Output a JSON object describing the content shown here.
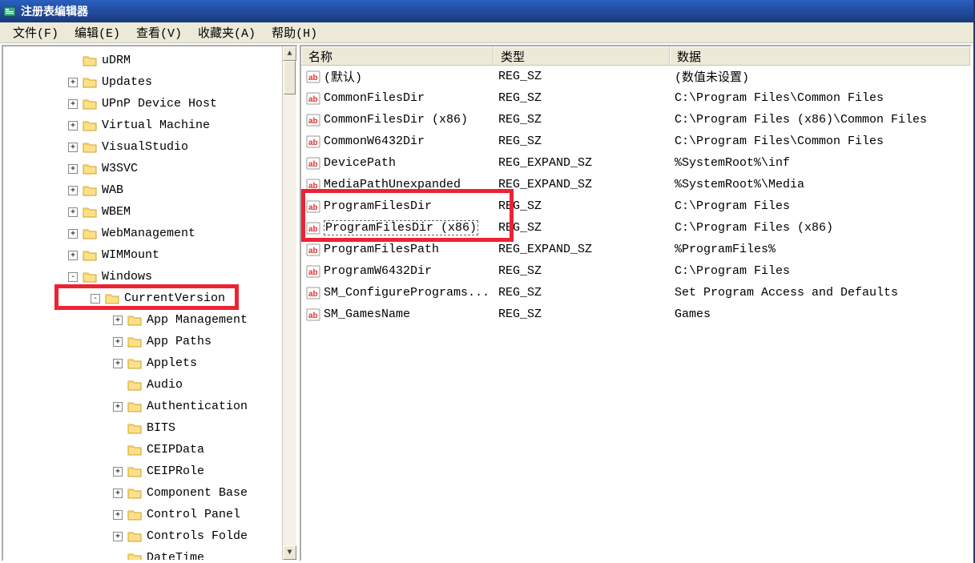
{
  "title": "注册表编辑器",
  "menubar": [
    {
      "label": "文件(F)"
    },
    {
      "label": "编辑(E)"
    },
    {
      "label": "查看(V)"
    },
    {
      "label": "收藏夹(A)"
    },
    {
      "label": "帮助(H)"
    }
  ],
  "columns": {
    "name": "名称",
    "type": "类型",
    "data": "数据"
  },
  "tree": [
    {
      "indent": 2,
      "exp": "",
      "label": "uDRM"
    },
    {
      "indent": 2,
      "exp": "+",
      "label": "Updates"
    },
    {
      "indent": 2,
      "exp": "+",
      "label": "UPnP Device Host"
    },
    {
      "indent": 2,
      "exp": "+",
      "label": "Virtual Machine"
    },
    {
      "indent": 2,
      "exp": "+",
      "label": "VisualStudio"
    },
    {
      "indent": 2,
      "exp": "+",
      "label": "W3SVC"
    },
    {
      "indent": 2,
      "exp": "+",
      "label": "WAB"
    },
    {
      "indent": 2,
      "exp": "+",
      "label": "WBEM"
    },
    {
      "indent": 2,
      "exp": "+",
      "label": "WebManagement"
    },
    {
      "indent": 2,
      "exp": "+",
      "label": "WIMMount"
    },
    {
      "indent": 2,
      "exp": "-",
      "label": "Windows"
    },
    {
      "indent": 3,
      "exp": "-",
      "label": "CurrentVersion",
      "hl": true
    },
    {
      "indent": 4,
      "exp": "+",
      "label": "App Management"
    },
    {
      "indent": 4,
      "exp": "+",
      "label": "App Paths"
    },
    {
      "indent": 4,
      "exp": "+",
      "label": "Applets"
    },
    {
      "indent": 4,
      "exp": "",
      "label": "Audio"
    },
    {
      "indent": 4,
      "exp": "+",
      "label": "Authentication"
    },
    {
      "indent": 4,
      "exp": "",
      "label": "BITS"
    },
    {
      "indent": 4,
      "exp": "",
      "label": "CEIPData"
    },
    {
      "indent": 4,
      "exp": "+",
      "label": "CEIPRole"
    },
    {
      "indent": 4,
      "exp": "+",
      "label": "Component Base"
    },
    {
      "indent": 4,
      "exp": "+",
      "label": "Control Panel"
    },
    {
      "indent": 4,
      "exp": "+",
      "label": "Controls Folde"
    },
    {
      "indent": 4,
      "exp": "",
      "label": "DateTime"
    }
  ],
  "values": [
    {
      "name": "(默认)",
      "type": "REG_SZ",
      "data": "(数值未设置)"
    },
    {
      "name": "CommonFilesDir",
      "type": "REG_SZ",
      "data": "C:\\Program Files\\Common Files"
    },
    {
      "name": "CommonFilesDir (x86)",
      "type": "REG_SZ",
      "data": "C:\\Program Files (x86)\\Common Files"
    },
    {
      "name": "CommonW6432Dir",
      "type": "REG_SZ",
      "data": "C:\\Program Files\\Common Files"
    },
    {
      "name": "DevicePath",
      "type": "REG_EXPAND_SZ",
      "data": "%SystemRoot%\\inf"
    },
    {
      "name": "MediaPathUnexpanded",
      "type": "REG_EXPAND_SZ",
      "data": "%SystemRoot%\\Media",
      "truncated": true
    },
    {
      "name": "ProgramFilesDir",
      "type": "REG_SZ",
      "data": "C:\\Program Files",
      "hl": true
    },
    {
      "name": "ProgramFilesDir (x86)",
      "type": "REG_SZ",
      "data": "C:\\Program Files (x86)",
      "hl": true,
      "selected": true
    },
    {
      "name": "ProgramFilesPath",
      "type": "REG_EXPAND_SZ",
      "data": "%ProgramFiles%"
    },
    {
      "name": "ProgramW6432Dir",
      "type": "REG_SZ",
      "data": "C:\\Program Files"
    },
    {
      "name": "SM_ConfigurePrograms...",
      "type": "REG_SZ",
      "data": "Set Program Access and Defaults"
    },
    {
      "name": "SM_GamesName",
      "type": "REG_SZ",
      "data": "Games"
    }
  ]
}
